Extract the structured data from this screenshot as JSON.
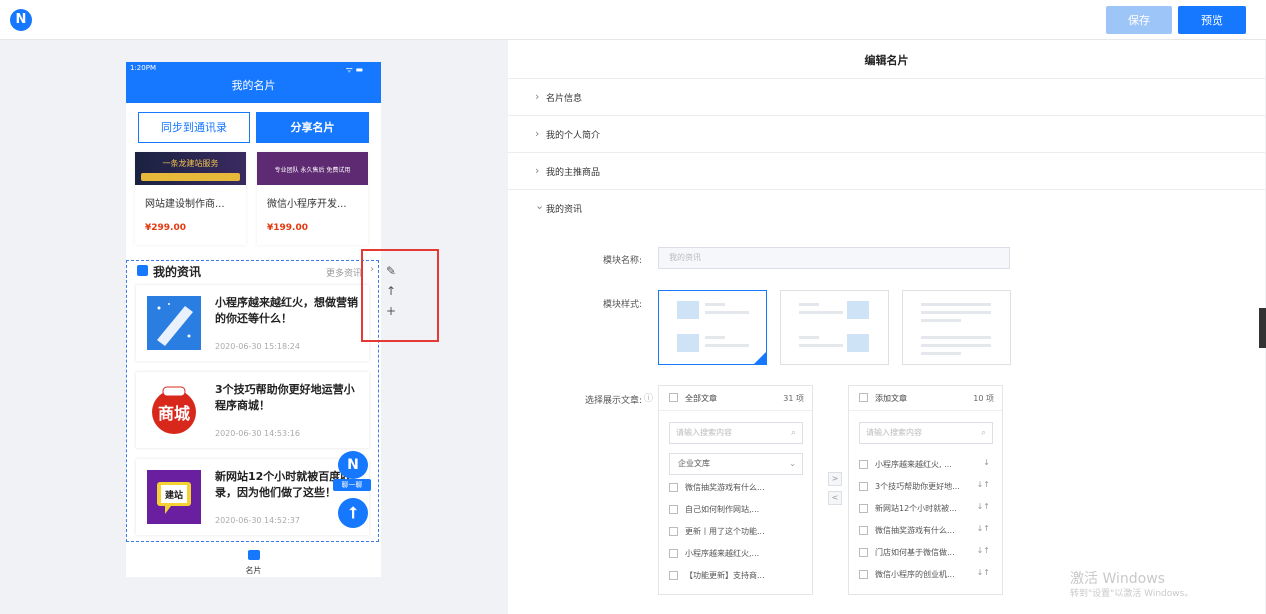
{
  "topbar": {
    "logo_letter": "N",
    "save_label": "保存",
    "preview_label": "预览",
    "colors": {
      "primary": "#1677ff",
      "disabled": "#9ec5f8"
    }
  },
  "phone": {
    "time": "1:20PM",
    "status": "ᯤ ▬",
    "title": "我的名片",
    "sync_label": "同步到通讯录",
    "share_label": "分享名片",
    "products": [
      {
        "banner": "一条龙建站服务",
        "name": "网站建设制作商...",
        "price": "¥299.00"
      },
      {
        "banner": "专业团队 永久售后 免费试用",
        "name": "微信小程序开发...",
        "price": "¥199.00"
      }
    ],
    "news_section": {
      "title": "我的资讯",
      "more": "更多资讯",
      "items": [
        {
          "title": "小程序越来越红火，想做营销的你还等什么！",
          "time": "2020-06-30 15:18:24",
          "thumb": "blue-star-icon"
        },
        {
          "title": "3个技巧帮助你更好地运营小程序商城！",
          "time": "2020-06-30 14:53:16",
          "thumb": "shop-hot-icon"
        },
        {
          "title": "新网站12个小时就被百度收录，因为他们做了这些！",
          "time": "2020-06-30 14:52:37",
          "thumb": "build-site-icon"
        }
      ]
    },
    "tab_label": "名片",
    "float_chat": "聊一聊"
  },
  "editor": {
    "title": "编辑名片",
    "sections": [
      {
        "label": "名片信息",
        "expanded": false
      },
      {
        "label": "我的个人简介",
        "expanded": false
      },
      {
        "label": "我的主推商品",
        "expanded": false
      },
      {
        "label": "我的资讯",
        "expanded": true
      }
    ],
    "module_name_label": "模块名称:",
    "module_name_placeholder": "我的资讯",
    "module_style_label": "模块样式:",
    "select_articles_label": "选择展示文章:",
    "left_list": {
      "title": "全部文章",
      "count": "31 项",
      "search_placeholder": "请输入搜索内容",
      "category": "企业文库",
      "items": [
        "微信抽奖游戏有什么...",
        "自己如何制作网站,...",
        "更新丨用了这个功能...",
        "小程序越来越红火,...",
        "【功能更新】支持商..."
      ]
    },
    "right_list": {
      "title": "添加文章",
      "count": "10 项",
      "search_placeholder": "请输入搜索内容",
      "items": [
        "小程序越来越红火, ...",
        "3个技巧帮助你更好地...",
        "新网站12个小时就被...",
        "微信抽奖游戏有什么...",
        "门店如何基于微信做...",
        "微信小程序的创业机..."
      ]
    }
  },
  "watermark": {
    "line1": "激活 Windows",
    "line2": "转到\"设置\"以激活 Windows。"
  }
}
